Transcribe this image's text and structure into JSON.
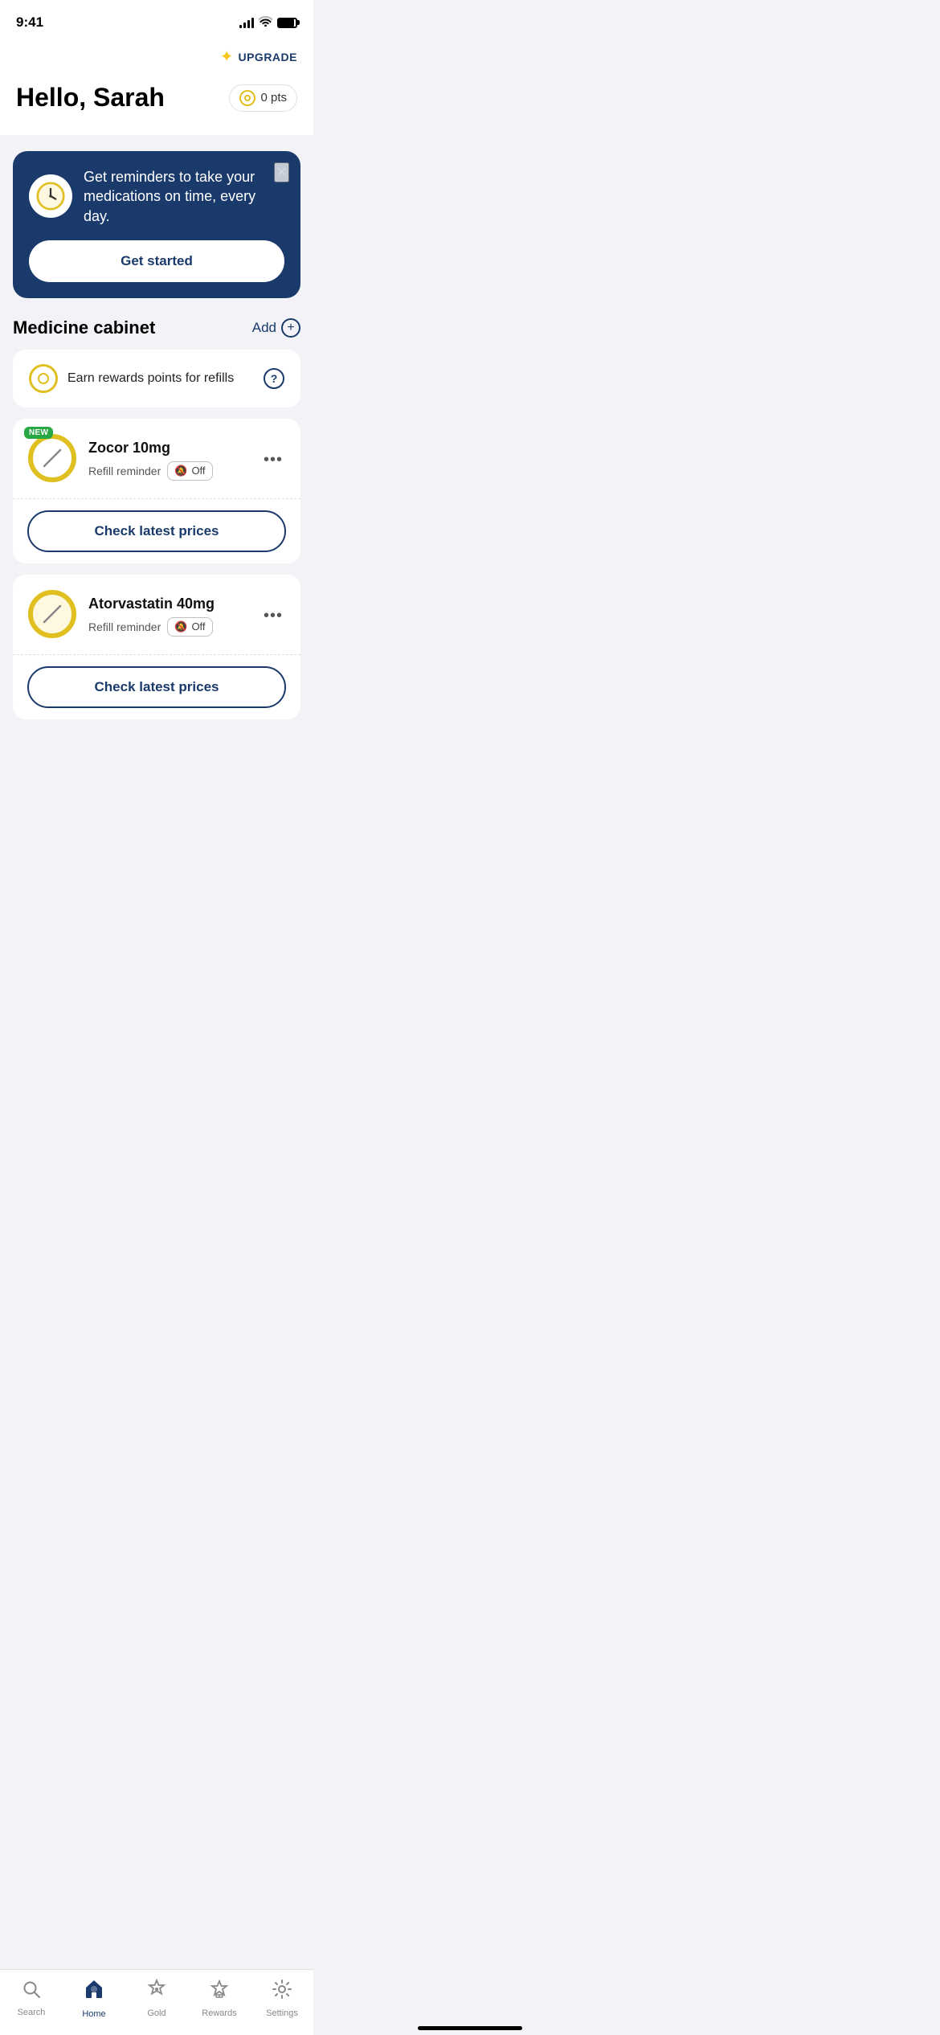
{
  "statusBar": {
    "time": "9:41"
  },
  "header": {
    "upgrade_label": "UPGRADE",
    "greeting": "Hello, Sarah",
    "points": "0 pts"
  },
  "reminderCard": {
    "text": "Get reminders to take your medications on time, every day.",
    "cta": "Get started"
  },
  "medicineSection": {
    "title": "Medicine cabinet",
    "add_label": "Add"
  },
  "rewardsCard": {
    "text": "Earn rewards points for refills"
  },
  "medications": [
    {
      "name": "Zocor 10mg",
      "refill_label": "Refill reminder",
      "refill_status": "Off",
      "is_new": true,
      "check_prices_label": "Check latest prices"
    },
    {
      "name": "Atorvastatin 40mg",
      "refill_label": "Refill reminder",
      "refill_status": "Off",
      "is_new": false,
      "check_prices_label": "Check latest prices"
    }
  ],
  "tabBar": {
    "items": [
      {
        "label": "Search",
        "icon": "search",
        "active": false
      },
      {
        "label": "Home",
        "icon": "home",
        "active": true
      },
      {
        "label": "Gold",
        "icon": "gold",
        "active": false
      },
      {
        "label": "Rewards",
        "icon": "rewards",
        "active": false
      },
      {
        "label": "Settings",
        "icon": "settings",
        "active": false
      }
    ]
  }
}
